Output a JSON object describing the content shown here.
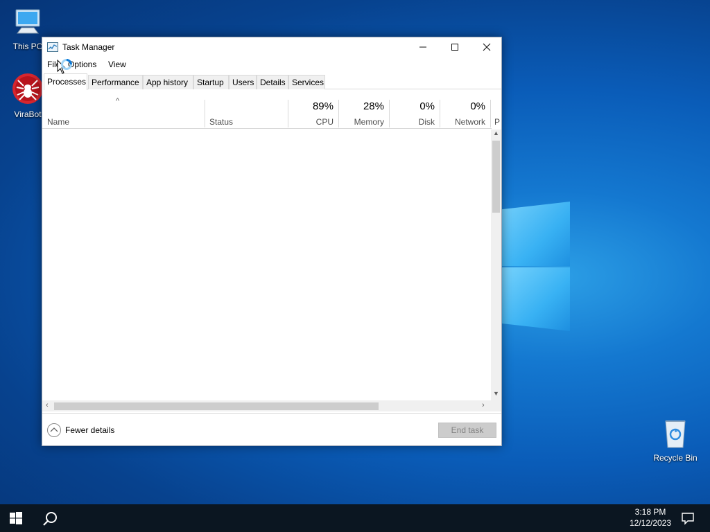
{
  "desktop": {
    "icons": [
      {
        "label": "This PC",
        "icon": "computer-icon"
      },
      {
        "label": "ViraBot",
        "icon": "spider-icon"
      },
      {
        "label": "Recycle Bin",
        "icon": "recycle-bin-icon"
      }
    ]
  },
  "window": {
    "title": "Task Manager",
    "controls": {
      "minimize": "—",
      "maximize": "☐",
      "close": "✕"
    },
    "menu": [
      "File",
      "Options",
      "View"
    ],
    "tabs": [
      "Processes",
      "Performance",
      "App history",
      "Startup",
      "Users",
      "Details",
      "Services"
    ],
    "active_tab": "Processes",
    "columns": {
      "name": {
        "label": "Name"
      },
      "status": {
        "label": "Status"
      },
      "cpu": {
        "value": "89%",
        "label": "CPU"
      },
      "memory": {
        "value": "28%",
        "label": "Memory"
      },
      "disk": {
        "value": "0%",
        "label": "Disk"
      },
      "network": {
        "value": "0%",
        "label": "Network"
      },
      "truncated": {
        "label": "P"
      }
    },
    "sort_indicator": "^",
    "footer": {
      "fewer_details": "Fewer details",
      "end_task": "End task"
    }
  },
  "taskbar": {
    "time": "3:18 PM",
    "date": "12/12/2023"
  },
  "colors": {
    "accent": "#0078d7",
    "taskbar": "#0b1621",
    "end_task_disabled": "#cccccc"
  }
}
